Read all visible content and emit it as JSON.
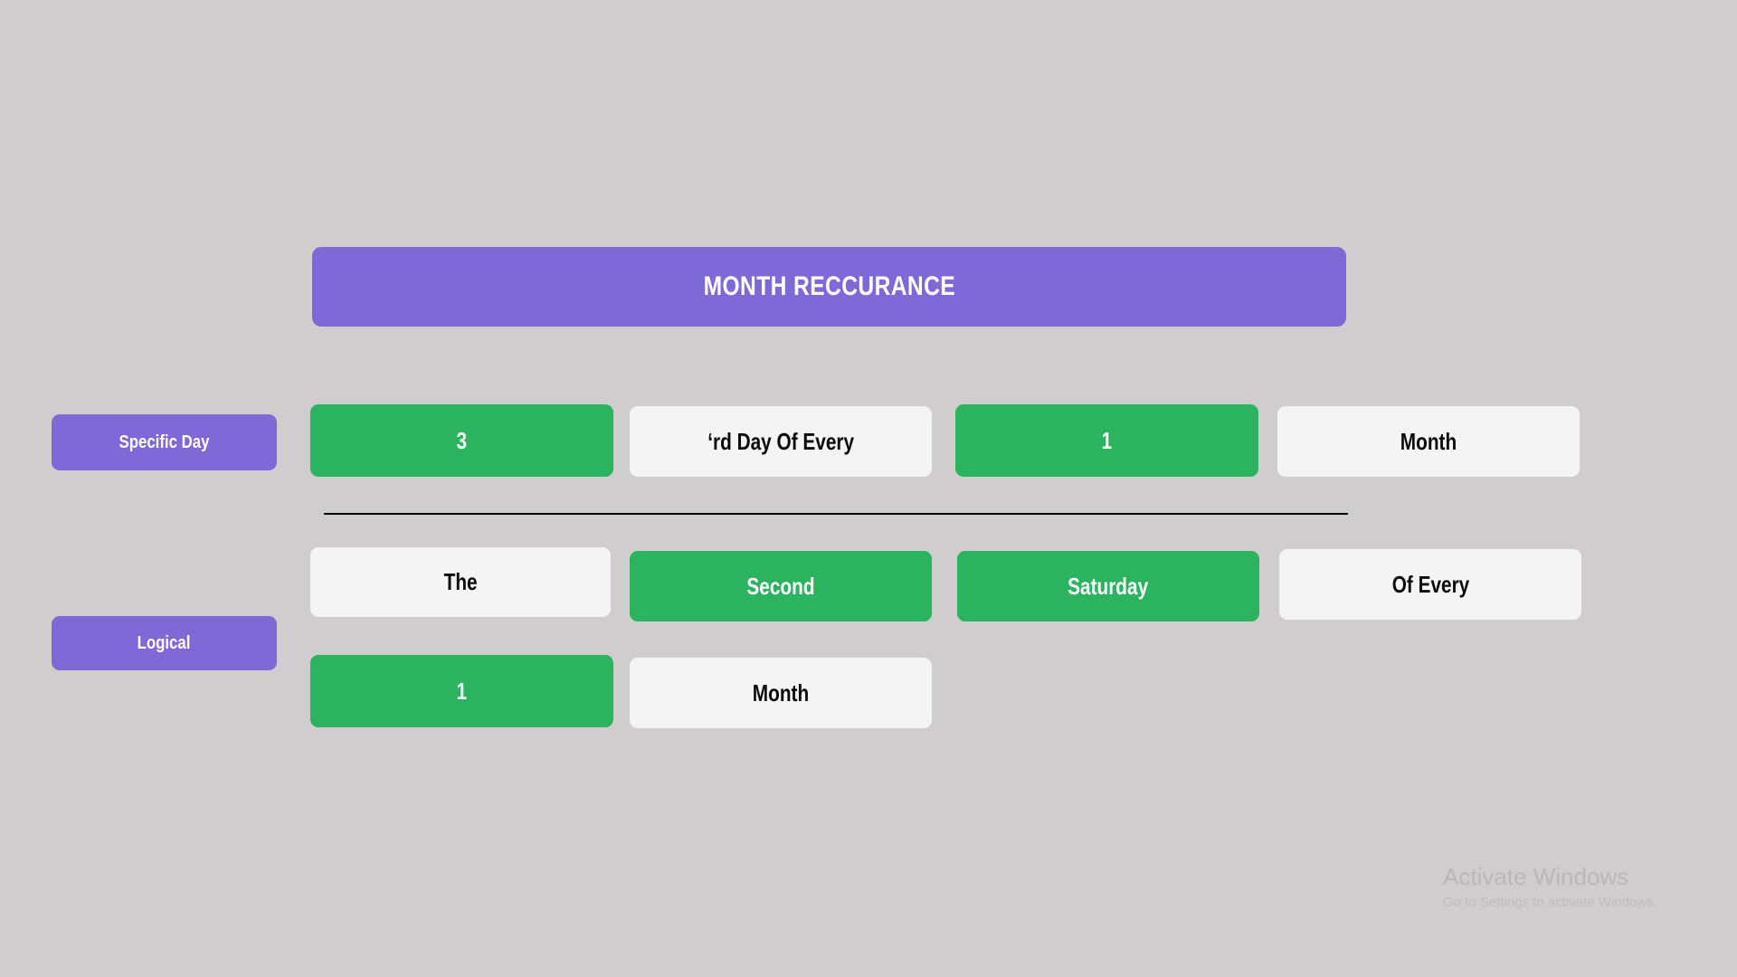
{
  "header": {
    "title": "MONTH RECCURANCE",
    "accent_color": "#7d6ad6"
  },
  "theme": {
    "background": "#cfcdce",
    "purple": "#7d6ad6",
    "green": "#2cb35f",
    "white_pill": "#f4f4f4",
    "text_dark": "#0a0a0a",
    "text_light": "#ffffff"
  },
  "rows": [
    {
      "label": "Specific Day",
      "pills": [
        {
          "text": "3",
          "state": "green"
        },
        {
          "text": "‘rd Day Of Every",
          "state": "white"
        },
        {
          "text": "1",
          "state": "green"
        },
        {
          "text": "Month",
          "state": "white"
        }
      ]
    },
    {
      "label": "Logical",
      "pills": [
        {
          "text": "The",
          "state": "white"
        },
        {
          "text": "Second",
          "state": "green"
        },
        {
          "text": "Saturday",
          "state": "green"
        },
        {
          "text": "Of Every",
          "state": "white"
        },
        {
          "text": "1",
          "state": "green"
        },
        {
          "text": "Month",
          "state": "white"
        }
      ]
    }
  ],
  "watermark": {
    "title": "Activate Windows",
    "subtitle": "Go to Settings to activate Windows."
  }
}
